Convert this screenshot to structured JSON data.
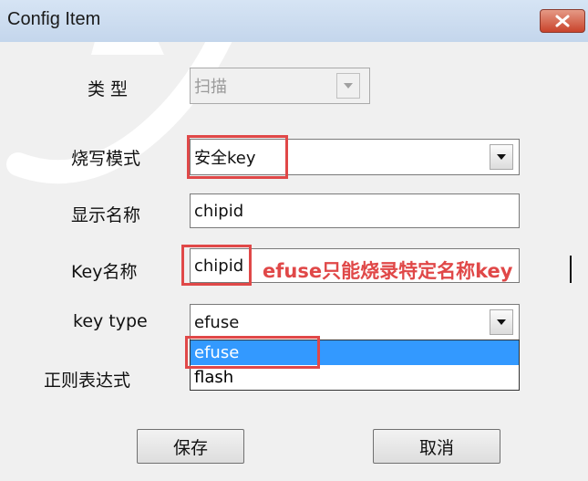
{
  "window": {
    "title": "Config Item"
  },
  "form": {
    "type": {
      "label": "类 型",
      "value": "扫描"
    },
    "burn_mode": {
      "label": "烧写模式",
      "value": "安全key"
    },
    "display_name": {
      "label": "显示名称",
      "value": "chipid"
    },
    "key_name": {
      "label": "Key名称",
      "value": "chipid"
    },
    "key_type": {
      "label": "key type",
      "value": "efuse",
      "options": [
        "efuse",
        "flash"
      ],
      "highlighted_option": "efuse"
    },
    "regex": {
      "label": "正则表达式"
    }
  },
  "annotation": {
    "text": "efuse只能烧录特定名称key",
    "color": "#e04848"
  },
  "buttons": {
    "save_label": "保存",
    "cancel_label": "取消"
  },
  "icons": {
    "close": "close-icon",
    "dropdown": "chevron-down-icon"
  },
  "colors": {
    "highlight_border": "#e04848",
    "selection": "#3399ff",
    "titlebar": "#c4d6ec"
  }
}
